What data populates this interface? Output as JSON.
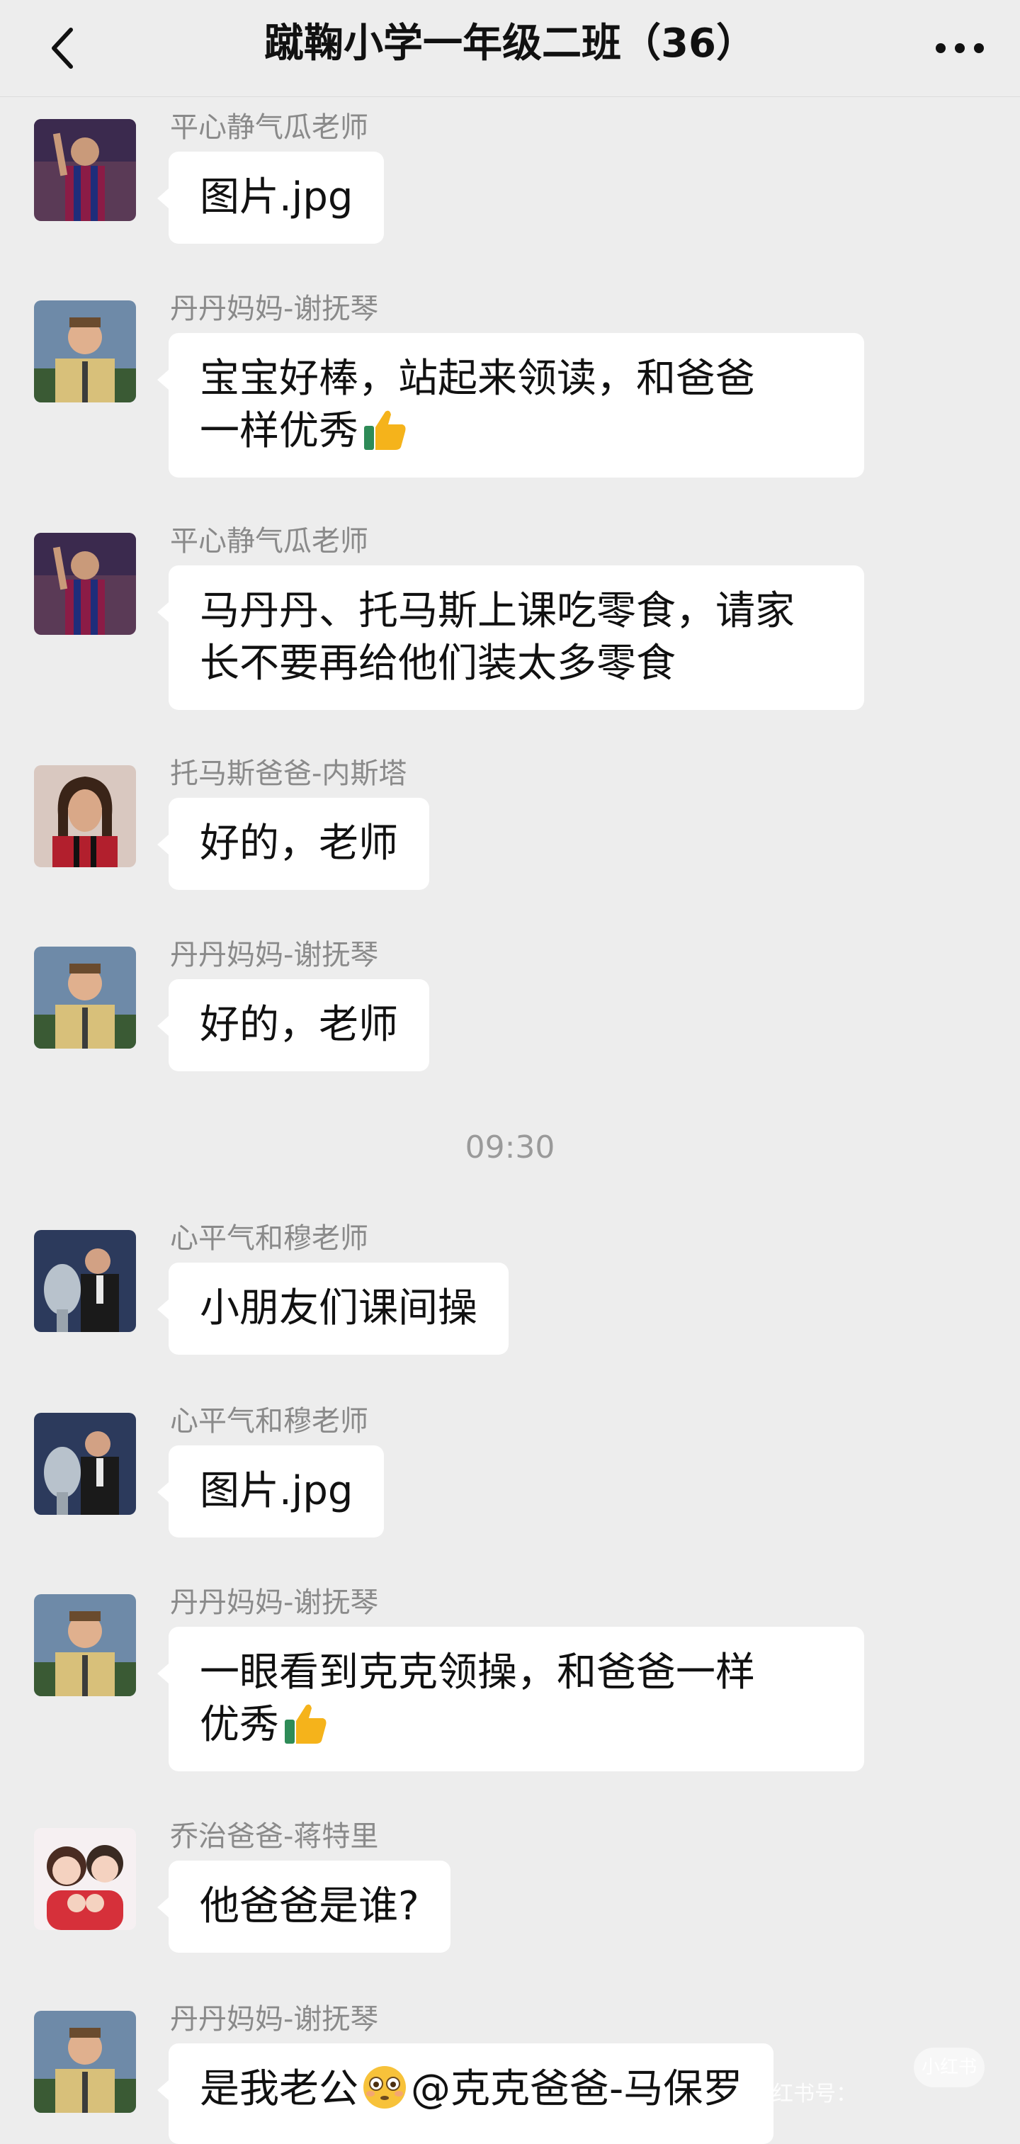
{
  "header": {
    "title": "蹴鞠小学一年级二班（36）"
  },
  "icons": {
    "back": "chevron-left-icon",
    "more": "more-dots-icon",
    "thumbs_up": "thumbs-up-emoji",
    "flushed": "flushed-face-emoji"
  },
  "colors": {
    "background": "#ededed",
    "bubble": "#ffffff",
    "sender_text": "#8a8a8a",
    "timestamp_text": "#9a9a9a"
  },
  "messages": [
    {
      "sender": "平心静气瓜老师",
      "text": "图片.jpg"
    },
    {
      "sender": "丹丹妈妈-谢抚琴",
      "line1": "宝宝好棒，站起来领读，和爸爸",
      "line2": "一样优秀"
    },
    {
      "sender": "平心静气瓜老师",
      "line1": "马丹丹、托马斯上课吃零食，请家",
      "line2": "长不要再给他们装太多零食"
    },
    {
      "sender": "托马斯爸爸-内斯塔",
      "text": "好的，老师"
    },
    {
      "sender": "丹丹妈妈-谢抚琴",
      "text": "好的，老师"
    },
    {
      "sender": "心平气和穆老师",
      "text": "小朋友们课间操"
    },
    {
      "sender": "心平气和穆老师",
      "text": "图片.jpg"
    },
    {
      "sender": "丹丹妈妈-谢抚琴",
      "line1": "一眼看到克克领操，和爸爸一样",
      "line2": "优秀"
    },
    {
      "sender": "乔治爸爸-蒋特里",
      "text": "他爸爸是谁?"
    },
    {
      "sender": "丹丹妈妈-谢抚琴",
      "text_before": "是我老公",
      "text_after": "@克克爸爸-马保罗"
    }
  ],
  "timestamp": "09:30",
  "watermark": {
    "text": "小红书号：",
    "logo": "小红书"
  }
}
